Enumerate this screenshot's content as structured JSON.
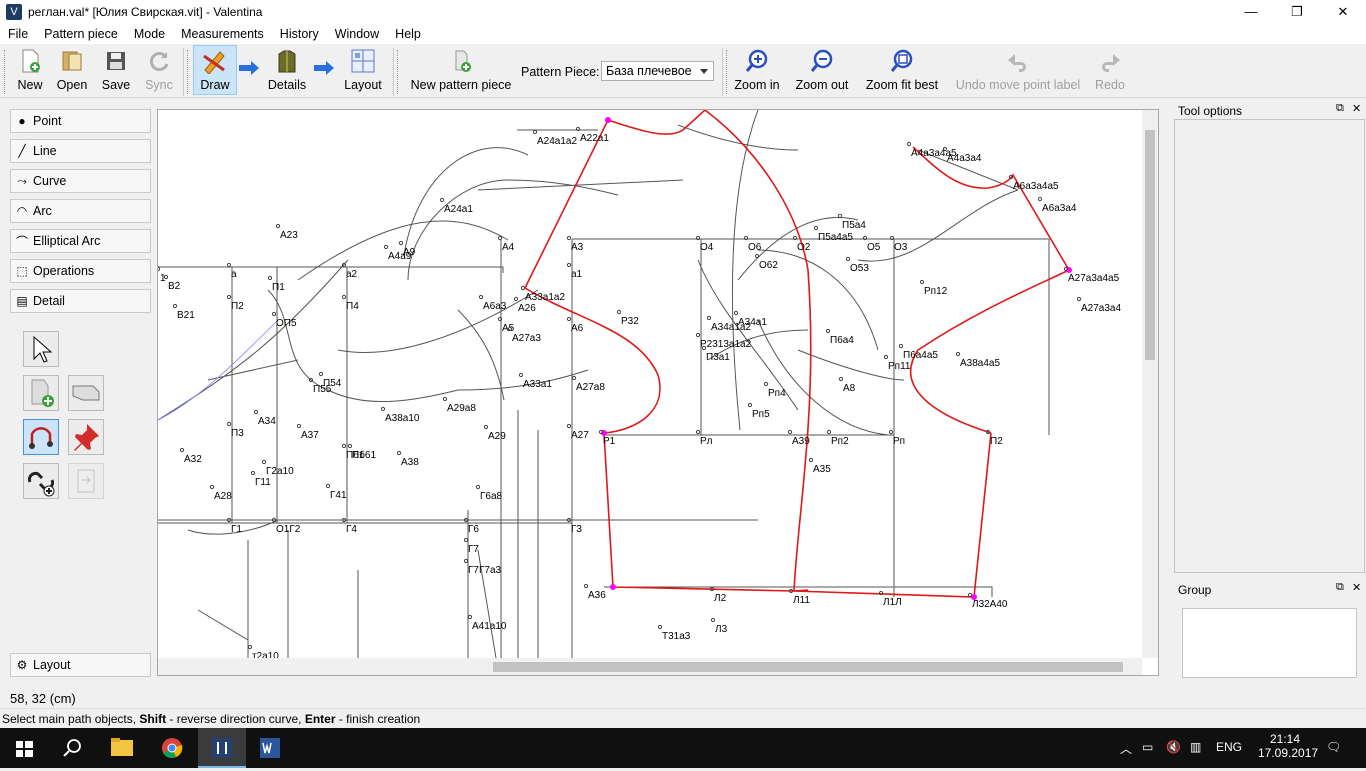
{
  "window": {
    "title": "реглан.val* [Юлия Свирская.vit] - Valentina",
    "minimize": "—",
    "maximize": "❐",
    "close": "✕"
  },
  "menu": [
    "File",
    "Pattern piece",
    "Mode",
    "Measurements",
    "History",
    "Window",
    "Help"
  ],
  "toolbar": {
    "new": "New",
    "open": "Open",
    "save": "Save",
    "sync": "Sync",
    "draw": "Draw",
    "details": "Details",
    "layout": "Layout",
    "new_piece": "New pattern piece",
    "piece_label": "Pattern Piece:",
    "piece_value": "База плечевое",
    "zoom_in": "Zoom in",
    "zoom_out": "Zoom out",
    "zoom_fit": "Zoom fit best",
    "undo": "Undo move point label",
    "redo": "Redo"
  },
  "tools": [
    "Point",
    "Line",
    "Curve",
    "Arc",
    "Elliptical Arc",
    "Operations",
    "Detail"
  ],
  "layout_button": "Layout",
  "docks": {
    "tool_options": "Tool options",
    "group": "Group"
  },
  "status": {
    "coords": "58, 32 (cm)",
    "hint_prefix": "Select main path objects, ",
    "hint_shift": "Shift",
    "hint_mid": " - reverse direction curve, ",
    "hint_enter": "Enter",
    "hint_suffix": " - finish creation"
  },
  "taskbar": {
    "lang": "ENG",
    "time": "21:14",
    "date": "17.09.2017"
  },
  "colors": {
    "contour": "#e02020",
    "point": "#ff00ff",
    "grid": "#404040"
  },
  "labels": [
    [
      "А24а1а2",
      537,
      144
    ],
    [
      "А22а1",
      580,
      141
    ],
    [
      "А24а1",
      444,
      212
    ],
    [
      "А23",
      280,
      238
    ],
    [
      "А4а9",
      388,
      259
    ],
    [
      "А9",
      403,
      255
    ],
    [
      "А4",
      502,
      250
    ],
    [
      "А3",
      571,
      250
    ],
    [
      "О4",
      700,
      250
    ],
    [
      "О6",
      748,
      250
    ],
    [
      "О2",
      797,
      250
    ],
    [
      "П5а4а5",
      818,
      240
    ],
    [
      "П5а4",
      842,
      228
    ],
    [
      "О5",
      867,
      250
    ],
    [
      "О3",
      894,
      250
    ],
    [
      "О62",
      759,
      268
    ],
    [
      "О53",
      850,
      271
    ],
    [
      "А4а3а4а5",
      911,
      156
    ],
    [
      "А4а3а4",
      947,
      161
    ],
    [
      "А6а3а4а5",
      1013,
      189
    ],
    [
      "А6а3а4",
      1042,
      211
    ],
    [
      "А27а3а4а5",
      1068,
      281
    ],
    [
      "А27а3а4",
      1081,
      311
    ],
    [
      "Рп12",
      924,
      294
    ],
    [
      "1",
      160,
      281
    ],
    [
      "В2",
      168,
      289
    ],
    [
      "а",
      231,
      277
    ],
    [
      "П1",
      272,
      290
    ],
    [
      "а2",
      346,
      277
    ],
    [
      "а1",
      571,
      277
    ],
    [
      "В21",
      177,
      318
    ],
    [
      "П2",
      231,
      309
    ],
    [
      "ОП5",
      276,
      326
    ],
    [
      "П4",
      346,
      309
    ],
    [
      "А33а1а2",
      525,
      300
    ],
    [
      "А6а3",
      483,
      309
    ],
    [
      "А26",
      518,
      311
    ],
    [
      "А5",
      502,
      331
    ],
    [
      "А6",
      571,
      331
    ],
    [
      "А27а3",
      512,
      341
    ],
    [
      "Р32",
      621,
      324
    ],
    [
      "А34а1а2",
      711,
      330
    ],
    [
      "А34а1",
      738,
      325
    ],
    [
      "Р2313а1а2",
      700,
      347
    ],
    [
      "П3а1",
      706,
      360
    ],
    [
      "П6а4",
      830,
      343
    ],
    [
      "П6а4а5",
      903,
      358
    ],
    [
      "Рп11",
      888,
      369
    ],
    [
      "А38а4а5",
      960,
      366
    ],
    [
      "П54",
      323,
      386
    ],
    [
      "П55",
      313,
      392
    ],
    [
      "А33а1",
      523,
      387
    ],
    [
      "А27а8",
      576,
      390
    ],
    [
      "Рп4",
      768,
      396
    ],
    [
      "А8",
      843,
      391
    ],
    [
      "А38а10",
      385,
      421
    ],
    [
      "А29а8",
      447,
      411
    ],
    [
      "Рп5",
      752,
      417
    ],
    [
      "П3",
      231,
      436
    ],
    [
      "А34",
      258,
      424
    ],
    [
      "А37",
      301,
      438
    ],
    [
      "А29",
      488,
      439
    ],
    [
      "А27",
      571,
      438
    ],
    [
      "Р1",
      603,
      444
    ],
    [
      "Рл",
      700,
      444
    ],
    [
      "А39",
      792,
      444
    ],
    [
      "Рп2",
      831,
      444
    ],
    [
      "Рп",
      893,
      444
    ],
    [
      "П61",
      346,
      458
    ],
    [
      "Пб61",
      352,
      458
    ],
    [
      "А38",
      401,
      465
    ],
    [
      "А35",
      813,
      472
    ],
    [
      "П2",
      990,
      444
    ],
    [
      "А32",
      184,
      462
    ],
    [
      "Г2а10",
      266,
      474
    ],
    [
      "Г11",
      255,
      485
    ],
    [
      "А28",
      214,
      499
    ],
    [
      "Г41",
      330,
      498
    ],
    [
      "Г6а8",
      480,
      499
    ],
    [
      "Г1",
      231,
      532
    ],
    [
      "О1Г2",
      276,
      532
    ],
    [
      "Г4",
      346,
      532
    ],
    [
      "Г6",
      468,
      532
    ],
    [
      "Г3",
      571,
      532
    ],
    [
      "Г7",
      468,
      552
    ],
    [
      "Г7Г7а3",
      468,
      573
    ],
    [
      "А36",
      588,
      598
    ],
    [
      "Л2",
      714,
      601
    ],
    [
      "Л11",
      793,
      603
    ],
    [
      "Л1Л",
      883,
      605
    ],
    [
      "Л32А40",
      972,
      607
    ],
    [
      "А41а10",
      472,
      629
    ],
    [
      "Л3",
      715,
      632
    ],
    [
      "Т31а3",
      662,
      639
    ],
    [
      "т2а10",
      252,
      659
    ]
  ]
}
